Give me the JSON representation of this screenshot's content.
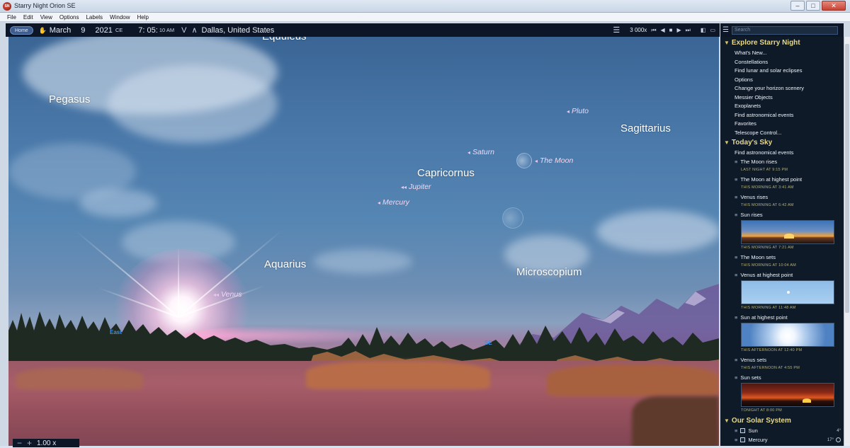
{
  "window": {
    "title": "Starry Night Orion SE",
    "min": "–",
    "max": "□",
    "close": "✕"
  },
  "menu": [
    "File",
    "Edit",
    "View",
    "Options",
    "Labels",
    "Window",
    "Help"
  ],
  "toolbar": {
    "home": "Home",
    "month": "March",
    "day": "9",
    "year": "2021",
    "era": "CE",
    "time": "7: 05:",
    "seconds": "10 AM",
    "arrows": "V ∧",
    "location": "Dallas, United States",
    "rate": "3 000x"
  },
  "sky": {
    "constellations": [
      "Equuleus",
      "Pegasus",
      "Sagittarius",
      "Capricornus",
      "Aquarius",
      "Microscopium"
    ],
    "planets": [
      "Pluto",
      "Saturn",
      "The Moon",
      "Jupiter",
      "Mercury",
      "Venus"
    ],
    "directions": [
      "East",
      "SE"
    ],
    "zoom": "1.00 x"
  },
  "sidebar": {
    "search_placeholder": "Search",
    "explore_title": "Explore Starry Night",
    "explore_items": [
      "What's New...",
      "Constellations",
      "Find lunar and solar eclipses",
      "Options",
      "Change your horizon scenery",
      "Messier Objects",
      "Exoplanets",
      "Find astronomical events",
      "Favorites",
      "Telescope Control..."
    ],
    "today_title": "Today's Sky",
    "today_link": "Find astronomical events",
    "events": [
      {
        "name": "The Moon rises",
        "time": "LAST NIGHT AT 9:15 PM"
      },
      {
        "name": "The Moon at highest point",
        "time": "THIS MORNING AT 3:41 AM"
      },
      {
        "name": "Venus rises",
        "time": "THIS MORNING AT 6:42 AM"
      },
      {
        "name": "Sun rises",
        "time": "THIS MORNING AT 7:21 AM"
      },
      {
        "name": "The Moon sets",
        "time": "THIS MORNING AT 10:04 AM"
      },
      {
        "name": "Venus at highest point",
        "time": "THIS MORNING AT 11:48 AM"
      },
      {
        "name": "Sun at highest point",
        "time": "THIS AFTERNOON AT 12:40 PM"
      },
      {
        "name": "Venus sets",
        "time": "THIS AFTERNOON AT 4:55 PM"
      },
      {
        "name": "Sun sets",
        "time": "TONIGHT AT 8:00 PM"
      }
    ],
    "solar_title": "Our Solar System",
    "solar_items": [
      {
        "name": "Sun",
        "value": "4°"
      },
      {
        "name": "Mercury",
        "value": "17°"
      }
    ]
  }
}
